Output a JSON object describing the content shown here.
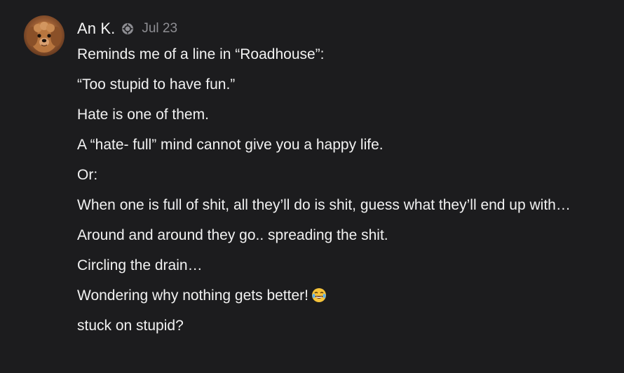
{
  "comment": {
    "author": "An K.",
    "date": "Jul 23",
    "badge_icon": "subscriber-badge-icon",
    "avatar_icon": "dog-avatar",
    "paragraphs": [
      "Reminds me of a line in “Roadhouse”:",
      "“Too stupid to have fun.”",
      "Hate is one of them.",
      "A “hate- full” mind cannot give you a happy life.",
      "Or:",
      "When one is full of shit, all they’ll do is shit, guess what they’ll end up with…",
      "Around and around they go.. spreading the shit.",
      "Circling the drain…",
      "Wondering why nothing gets better!",
      "stuck on stupid?"
    ],
    "emoji_icon": "laughing-tears-emoji"
  },
  "colors": {
    "background": "#1c1c1e",
    "text": "#f2f2f2",
    "muted": "#8e8e93"
  }
}
